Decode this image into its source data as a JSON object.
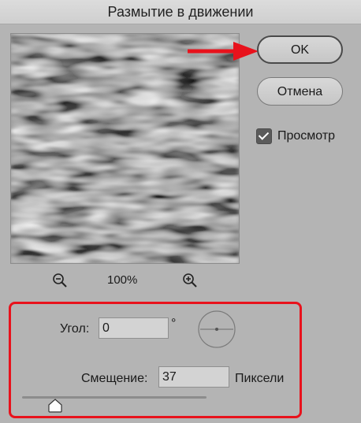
{
  "window": {
    "title": "Размытие в движении"
  },
  "buttons": {
    "ok": "OK",
    "cancel": "Отмена"
  },
  "preview": {
    "label": "Просмотр",
    "checked": true,
    "zoom": "100%"
  },
  "params": {
    "angle_label": "Угол:",
    "angle_value": "0",
    "angle_unit": "°",
    "distance_label": "Смещение:",
    "distance_value": "37",
    "distance_unit": "Пиксели",
    "distance_slider_fraction": 0.18
  },
  "colors": {
    "highlight": "#e8121c",
    "dialog_bg": "#b4b4b4"
  },
  "icons": [
    "zoom-out-icon",
    "zoom-in-icon",
    "angle-dial",
    "slider-thumb",
    "red-arrow"
  ]
}
